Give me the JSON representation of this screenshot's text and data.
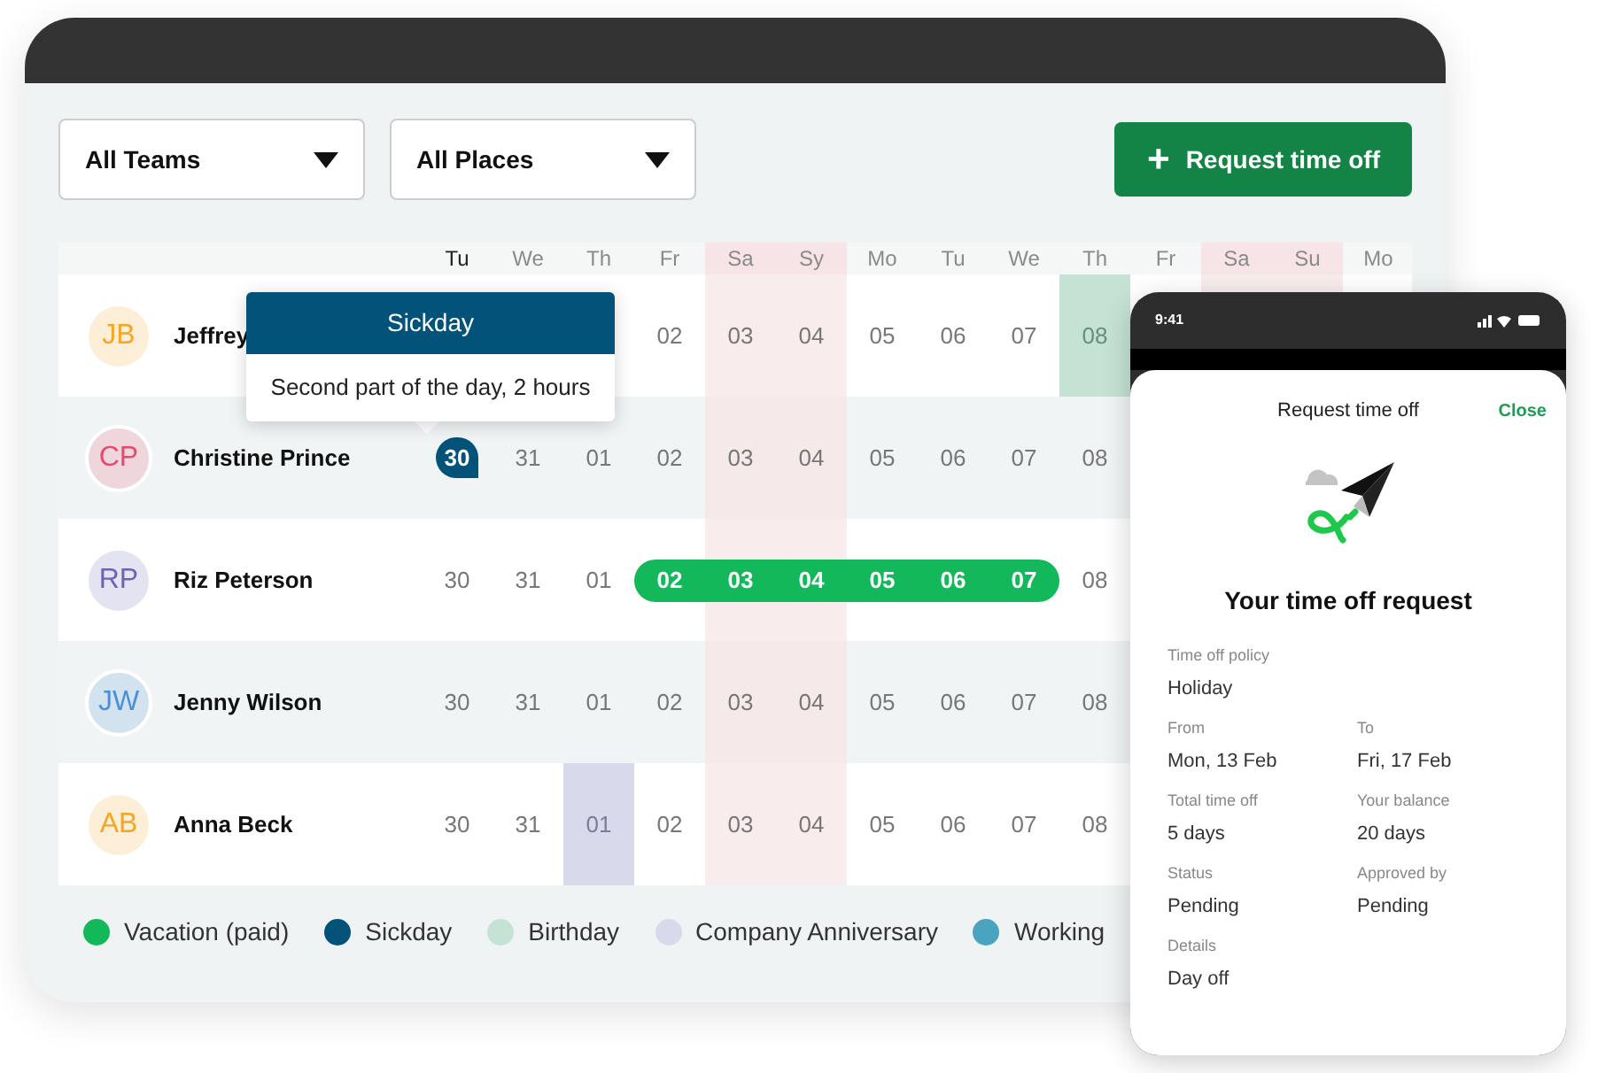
{
  "filters": [
    {
      "label": "All Teams"
    },
    {
      "label": "All Places"
    }
  ],
  "request_button": {
    "icon": "+",
    "label": "Request time off"
  },
  "calendar": {
    "columns": [
      {
        "label": "Tu",
        "today": true,
        "weekend": false
      },
      {
        "label": "We",
        "today": false,
        "weekend": false
      },
      {
        "label": "Th",
        "today": false,
        "weekend": false
      },
      {
        "label": "Fr",
        "today": false,
        "weekend": false
      },
      {
        "label": "Sa",
        "today": false,
        "weekend": true
      },
      {
        "label": "Sy",
        "today": false,
        "weekend": true
      },
      {
        "label": "Mo",
        "today": false,
        "weekend": false
      },
      {
        "label": "Tu",
        "today": false,
        "weekend": false
      },
      {
        "label": "We",
        "today": false,
        "weekend": false
      },
      {
        "label": "Th",
        "today": false,
        "weekend": false
      },
      {
        "label": "Fr",
        "today": false,
        "weekend": false
      },
      {
        "label": "Sa",
        "today": false,
        "weekend": true
      },
      {
        "label": "Su",
        "today": false,
        "weekend": true
      },
      {
        "label": "Mo",
        "today": false,
        "weekend": false
      }
    ],
    "rows": [
      {
        "initials": "JB",
        "name": "Jeffrey",
        "color": "#f5a623",
        "cells": [
          {
            "kind": "covered"
          },
          {
            "kind": "covered"
          },
          {
            "kind": "covered"
          },
          {
            "kind": "plain",
            "text": "02"
          },
          {
            "kind": "plain",
            "text": "03"
          },
          {
            "kind": "plain",
            "text": "04"
          },
          {
            "kind": "plain",
            "text": "05"
          },
          {
            "kind": "plain",
            "text": "06"
          },
          {
            "kind": "plain",
            "text": "07"
          },
          {
            "kind": "birthday",
            "text": "08"
          }
        ]
      },
      {
        "initials": "CP",
        "name": "Christine Prince",
        "color": "#e84a6f",
        "cells": [
          {
            "kind": "sickday",
            "text": "30"
          },
          {
            "kind": "plain",
            "text": "31"
          },
          {
            "kind": "plain",
            "text": "01"
          },
          {
            "kind": "plain",
            "text": "02"
          },
          {
            "kind": "plain",
            "text": "03"
          },
          {
            "kind": "plain",
            "text": "04"
          },
          {
            "kind": "plain",
            "text": "05"
          },
          {
            "kind": "plain",
            "text": "06"
          },
          {
            "kind": "plain",
            "text": "07"
          },
          {
            "kind": "plain",
            "text": "08"
          }
        ]
      },
      {
        "initials": "RP",
        "name": "Riz Peterson",
        "color": "#6c63b5",
        "cells": [
          {
            "kind": "plain",
            "text": "30"
          },
          {
            "kind": "plain",
            "text": "31"
          },
          {
            "kind": "plain",
            "text": "01"
          },
          {
            "kind": "vacation",
            "text": "02"
          },
          {
            "kind": "vacation",
            "text": "03"
          },
          {
            "kind": "vacation",
            "text": "04"
          },
          {
            "kind": "vacation",
            "text": "05"
          },
          {
            "kind": "vacation",
            "text": "06"
          },
          {
            "kind": "vacation",
            "text": "07"
          },
          {
            "kind": "plain",
            "text": "08"
          }
        ]
      },
      {
        "initials": "JW",
        "name": "Jenny Wilson",
        "color": "#4a90d9",
        "cells": [
          {
            "kind": "plain",
            "text": "30"
          },
          {
            "kind": "plain",
            "text": "31"
          },
          {
            "kind": "plain",
            "text": "01"
          },
          {
            "kind": "plain",
            "text": "02"
          },
          {
            "kind": "plain",
            "text": "03"
          },
          {
            "kind": "plain",
            "text": "04"
          },
          {
            "kind": "plain",
            "text": "05"
          },
          {
            "kind": "plain",
            "text": "06"
          },
          {
            "kind": "plain",
            "text": "07"
          },
          {
            "kind": "plain",
            "text": "08"
          }
        ]
      },
      {
        "initials": "AB",
        "name": "Anna Beck",
        "color": "#f5a623",
        "cells": [
          {
            "kind": "plain",
            "text": "30"
          },
          {
            "kind": "plain",
            "text": "31"
          },
          {
            "kind": "anniversary",
            "text": "01"
          },
          {
            "kind": "plain",
            "text": "02"
          },
          {
            "kind": "plain",
            "text": "03"
          },
          {
            "kind": "plain",
            "text": "04"
          },
          {
            "kind": "plain",
            "text": "05"
          },
          {
            "kind": "plain",
            "text": "06"
          },
          {
            "kind": "plain",
            "text": "07"
          },
          {
            "kind": "plain",
            "text": "08"
          }
        ]
      }
    ]
  },
  "tooltip": {
    "title": "Sickday",
    "text": "Second part of the day, 2 hours"
  },
  "legend": [
    {
      "label": "Vacation (paid)",
      "color": "#13b85a"
    },
    {
      "label": "Sickday",
      "color": "#03527a"
    },
    {
      "label": "Birthday",
      "color": "#c5e3d5"
    },
    {
      "label": "Company Anniversary",
      "color": "#d8daeb"
    },
    {
      "label": "Working",
      "color": "#4aa3c0"
    }
  ],
  "phone": {
    "time": "9:41",
    "title": "Request time off",
    "close": "Close",
    "heading": "Your time off request",
    "fields": [
      {
        "label": "Time off policy",
        "value": "Holiday",
        "kind": "full"
      },
      {
        "label": "From",
        "value": "Mon, 13 Feb",
        "kind": "half"
      },
      {
        "label": "To",
        "value": "Fri, 17 Feb",
        "kind": "half"
      },
      {
        "label": "Total time off",
        "value": "5 days",
        "kind": "half"
      },
      {
        "label": "Your balance",
        "value": "20 days",
        "kind": "half"
      },
      {
        "label": "Status",
        "value": "Pending",
        "kind": "half"
      },
      {
        "label": "Approved by",
        "value": "Pending",
        "kind": "half"
      },
      {
        "label": "Details",
        "value": "Day off",
        "kind": "full"
      }
    ]
  }
}
